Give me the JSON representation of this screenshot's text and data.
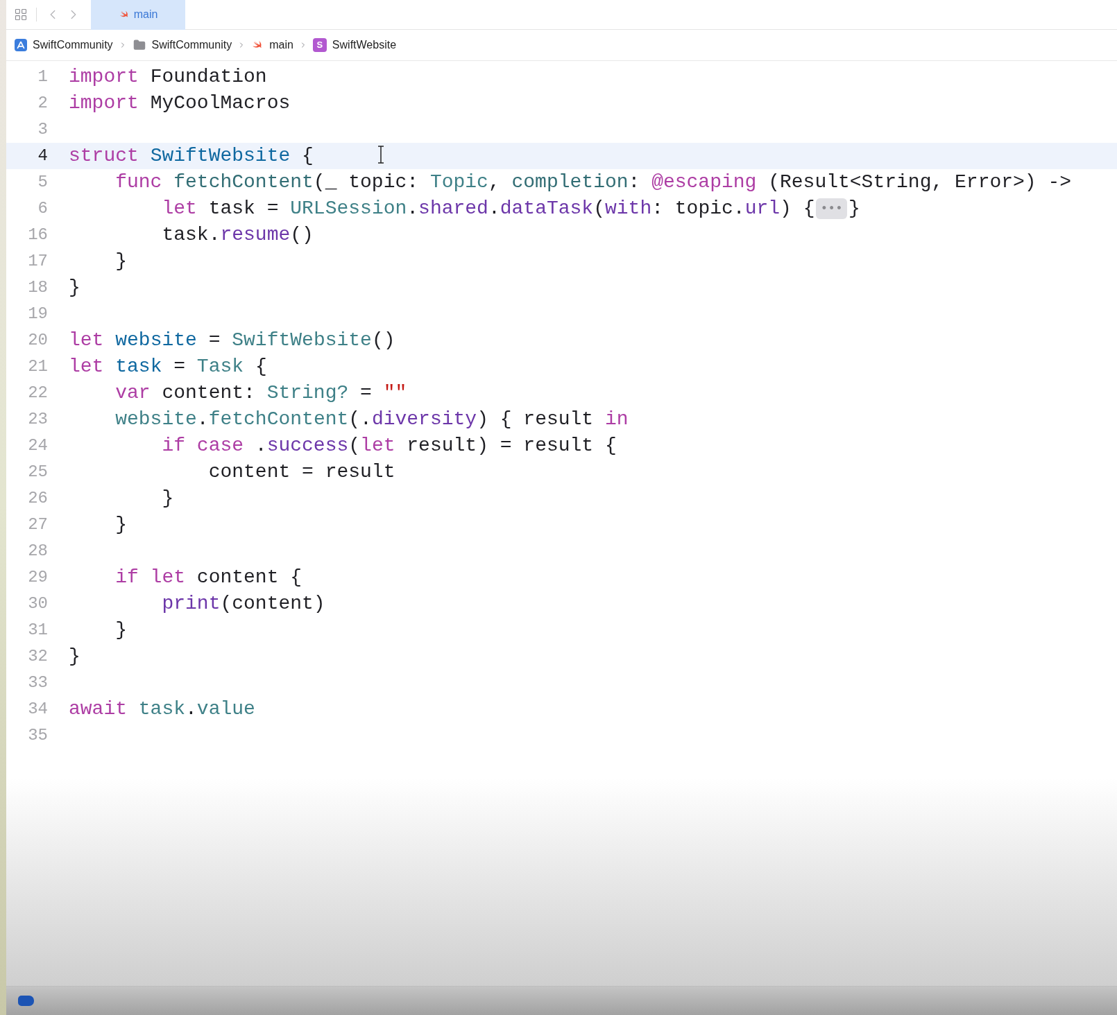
{
  "tab_bar": {
    "tabs": [
      {
        "label": "main",
        "selected": true
      }
    ]
  },
  "breadcrumb": {
    "items": [
      {
        "kind": "project",
        "label": "SwiftCommunity"
      },
      {
        "kind": "folder",
        "label": "SwiftCommunity"
      },
      {
        "kind": "swift",
        "label": "main"
      },
      {
        "kind": "symbol",
        "badge": "S",
        "label": "SwiftWebsite"
      }
    ]
  },
  "editor": {
    "lines": [
      {
        "number": "1",
        "selected": false,
        "tokens": [
          {
            "kind": "keyword",
            "t": "import"
          },
          {
            "kind": "plain",
            "t": " Foundation"
          }
        ]
      },
      {
        "number": "2",
        "selected": false,
        "tokens": [
          {
            "kind": "keyword",
            "t": "import"
          },
          {
            "kind": "plain",
            "t": " MyCoolMacros"
          }
        ]
      },
      {
        "number": "3",
        "selected": false
      },
      {
        "number": "4",
        "selected": true,
        "tokens": [
          {
            "kind": "keyword",
            "t": "struct"
          },
          {
            "kind": "declaration",
            "t": " SwiftWebsite"
          },
          {
            "kind": "plain",
            "t": " {"
          }
        ]
      },
      {
        "number": "5",
        "selected": false,
        "tokens": [
          {
            "kind": "keyword",
            "t": "    func"
          },
          {
            "kind": "function",
            "t": " fetchContent"
          },
          {
            "kind": "plain",
            "t": "(_ topic: "
          },
          {
            "kind": "type",
            "t": "Topic"
          },
          {
            "kind": "plain",
            "t": ", "
          },
          {
            "kind": "function",
            "t": "completion"
          },
          {
            "kind": "plain",
            "t": ": "
          },
          {
            "kind": "keyword",
            "t": "@escaping"
          },
          {
            "kind": "plain",
            "t": " (Result<String, Error>) ->"
          }
        ]
      },
      {
        "number": "6",
        "selected": false,
        "tokens": [
          {
            "kind": "keyword",
            "t": "        let"
          },
          {
            "kind": "plain",
            "t": " task = "
          },
          {
            "kind": "type",
            "t": "URLSession"
          },
          {
            "kind": "plain",
            "t": "."
          },
          {
            "kind": "member",
            "t": "shared"
          },
          {
            "kind": "plain",
            "t": "."
          },
          {
            "kind": "member",
            "t": "dataTask"
          },
          {
            "kind": "plain",
            "t": "("
          },
          {
            "kind": "member",
            "t": "with"
          },
          {
            "kind": "plain",
            "t": ": topic."
          },
          {
            "kind": "member",
            "t": "url"
          },
          {
            "kind": "plain",
            "t": ") {"
          },
          {
            "kind": "fold",
            "t": "•••"
          },
          {
            "kind": "plain",
            "t": "}"
          }
        ]
      },
      {
        "number": "16",
        "selected": false,
        "tokens": [
          {
            "kind": "plain",
            "t": "        task."
          },
          {
            "kind": "member",
            "t": "resume"
          },
          {
            "kind": "plain",
            "t": "()"
          }
        ]
      },
      {
        "number": "17",
        "selected": false,
        "tokens": [
          {
            "kind": "plain",
            "t": "    }"
          }
        ]
      },
      {
        "number": "18",
        "selected": false,
        "tokens": [
          {
            "kind": "plain",
            "t": "}"
          }
        ]
      },
      {
        "number": "19",
        "selected": false
      },
      {
        "number": "20",
        "selected": false,
        "tokens": [
          {
            "kind": "keyword",
            "t": "let"
          },
          {
            "kind": "declaration",
            "t": " website"
          },
          {
            "kind": "plain",
            "t": " = "
          },
          {
            "kind": "type",
            "t": "SwiftWebsite"
          },
          {
            "kind": "plain",
            "t": "()"
          }
        ]
      },
      {
        "number": "21",
        "selected": false,
        "tokens": [
          {
            "kind": "keyword",
            "t": "let"
          },
          {
            "kind": "declaration",
            "t": " task"
          },
          {
            "kind": "plain",
            "t": " = "
          },
          {
            "kind": "type",
            "t": "Task"
          },
          {
            "kind": "plain",
            "t": " {"
          }
        ]
      },
      {
        "number": "22",
        "selected": false,
        "tokens": [
          {
            "kind": "keyword",
            "t": "    var"
          },
          {
            "kind": "plain",
            "t": " content: "
          },
          {
            "kind": "type",
            "t": "String?"
          },
          {
            "kind": "plain",
            "t": " = "
          },
          {
            "kind": "string",
            "t": "\"\""
          }
        ]
      },
      {
        "number": "23",
        "selected": false,
        "tokens": [
          {
            "kind": "type",
            "t": "    website"
          },
          {
            "kind": "plain",
            "t": "."
          },
          {
            "kind": "type",
            "t": "fetchContent"
          },
          {
            "kind": "plain",
            "t": "(."
          },
          {
            "kind": "member",
            "t": "diversity"
          },
          {
            "kind": "plain",
            "t": ") { result "
          },
          {
            "kind": "keyword",
            "t": "in"
          }
        ]
      },
      {
        "number": "24",
        "selected": false,
        "tokens": [
          {
            "kind": "keyword",
            "t": "        if case"
          },
          {
            "kind": "plain",
            "t": " ."
          },
          {
            "kind": "member",
            "t": "success"
          },
          {
            "kind": "plain",
            "t": "("
          },
          {
            "kind": "keyword",
            "t": "let"
          },
          {
            "kind": "plain",
            "t": " result) = result {"
          }
        ]
      },
      {
        "number": "25",
        "selected": false,
        "tokens": [
          {
            "kind": "plain",
            "t": "            content = result"
          }
        ]
      },
      {
        "number": "26",
        "selected": false,
        "tokens": [
          {
            "kind": "plain",
            "t": "        }"
          }
        ]
      },
      {
        "number": "27",
        "selected": false,
        "tokens": [
          {
            "kind": "plain",
            "t": "    }"
          }
        ]
      },
      {
        "number": "28",
        "selected": false
      },
      {
        "number": "29",
        "selected": false,
        "tokens": [
          {
            "kind": "keyword",
            "t": "    if let"
          },
          {
            "kind": "plain",
            "t": " content {"
          }
        ]
      },
      {
        "number": "30",
        "selected": false,
        "tokens": [
          {
            "kind": "member",
            "t": "        print"
          },
          {
            "kind": "plain",
            "t": "(content)"
          }
        ]
      },
      {
        "number": "31",
        "selected": false,
        "tokens": [
          {
            "kind": "plain",
            "t": "    }"
          }
        ]
      },
      {
        "number": "32",
        "selected": false,
        "tokens": [
          {
            "kind": "plain",
            "t": "}"
          }
        ]
      },
      {
        "number": "33",
        "selected": false
      },
      {
        "number": "34",
        "selected": false,
        "tokens": [
          {
            "kind": "keyword",
            "t": "await"
          },
          {
            "kind": "type",
            "t": " task"
          },
          {
            "kind": "plain",
            "t": "."
          },
          {
            "kind": "type",
            "t": "value"
          }
        ]
      },
      {
        "number": "35",
        "selected": false
      }
    ]
  }
}
